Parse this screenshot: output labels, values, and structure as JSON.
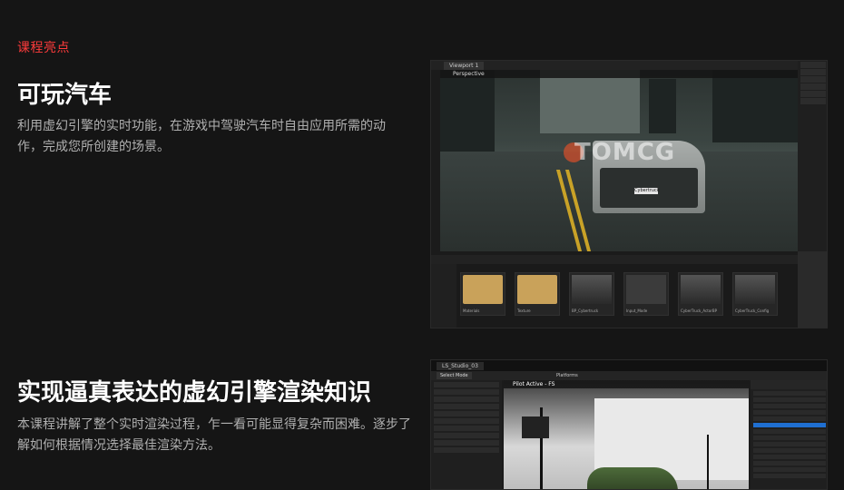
{
  "section": {
    "eyebrow": "课程亮点",
    "accent_color": "#ff3b3b"
  },
  "feature1": {
    "title": "可玩汽车",
    "description": "利用虚幻引擎的实时功能，在游戏中驾驶汽车时自由应用所需的动作，完成您所创建的场景。",
    "screenshot": {
      "viewport_tab": "Viewport 1",
      "viewport_label": "Perspective",
      "watermark": "TOMCG",
      "plate": "Cybertruck",
      "assets": [
        {
          "name": "Materials",
          "kind": "folder"
        },
        {
          "name": "Texture",
          "kind": "folder"
        },
        {
          "name": "BP_Cybertruck",
          "kind": "car"
        },
        {
          "name": "Input_Mode",
          "kind": "gamepad"
        },
        {
          "name": "CyberTruck_ActorBP",
          "kind": "car"
        },
        {
          "name": "CyberTruck_Config",
          "kind": "car"
        }
      ]
    }
  },
  "feature2": {
    "title": "实现逼真表达的虚幻引擎渲染知识",
    "description": "本课程讲解了整个实时渲染过程，乍一看可能显得复杂而困难。逐步了解如何根据情况选择最佳渲染方法。",
    "screenshot": {
      "tab": "LS_Studio_03",
      "select_mode": "Select Mode",
      "platforms": "Platforms",
      "viewport_label": "Pilot Active - FS"
    }
  }
}
